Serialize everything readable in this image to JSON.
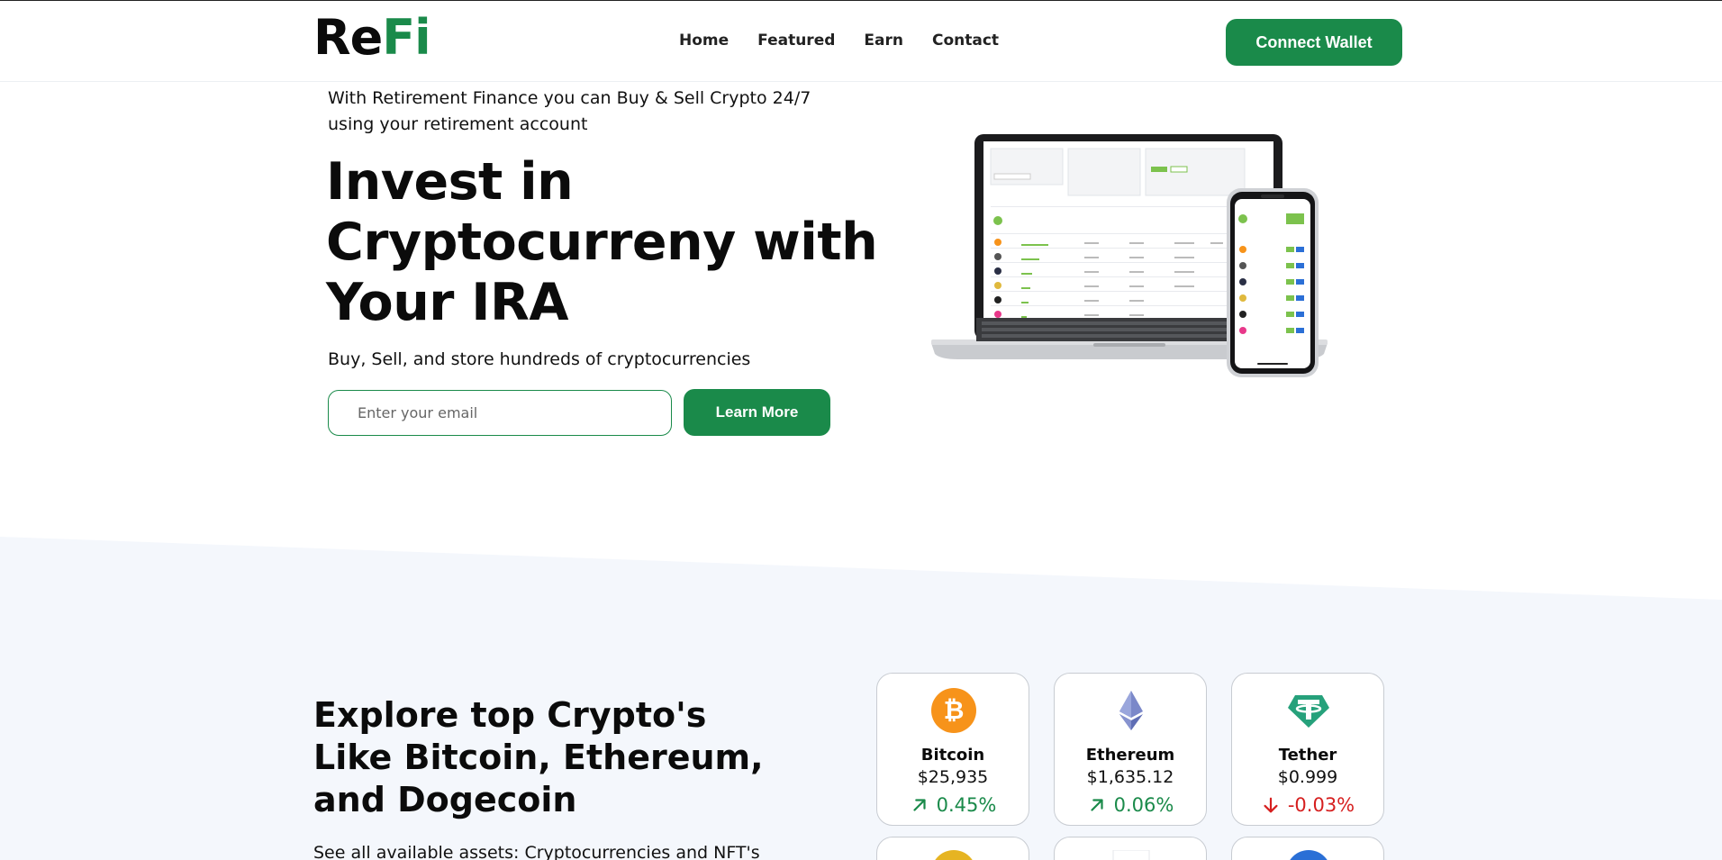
{
  "brand": {
    "logo_part1": "Re",
    "logo_part2": "Fi",
    "accent_color": "#1a8a4a"
  },
  "nav": {
    "items": [
      "Home",
      "Featured",
      "Earn",
      "Contact"
    ],
    "connect_label": "Connect Wallet"
  },
  "hero": {
    "intro": "With Retirement Finance you can Buy & Sell Crypto 24/7 using your retirement account",
    "title": "Invest in Cryptocurreny with Your IRA",
    "subtitle": "Buy, Sell, and store hundreds of cryptocurrencies",
    "email_placeholder": "Enter your email",
    "cta_label": "Learn More",
    "device_image": "laptop-and-phone-dashboard"
  },
  "explore": {
    "title": "Explore top Crypto's Like Bitcoin, Ethereum, and Dogecoin",
    "subtitle": "See all available assets: Cryptocurrencies and NFT's"
  },
  "coins": [
    {
      "name": "Bitcoin",
      "price": "$25,935",
      "change": "0.45%",
      "direction": "up",
      "icon": "bitcoin-icon",
      "color": "#f7931a"
    },
    {
      "name": "Ethereum",
      "price": "$1,635.12",
      "change": "0.06%",
      "direction": "up",
      "icon": "ethereum-icon",
      "color": "#627eea"
    },
    {
      "name": "Tether",
      "price": "$0.999",
      "change": "-0.03%",
      "direction": "down",
      "icon": "tether-icon",
      "color": "#26a17b"
    }
  ],
  "colors": {
    "up": "#1a8a4a",
    "down": "#d61f1f",
    "section_bg": "#f4f7fc"
  }
}
